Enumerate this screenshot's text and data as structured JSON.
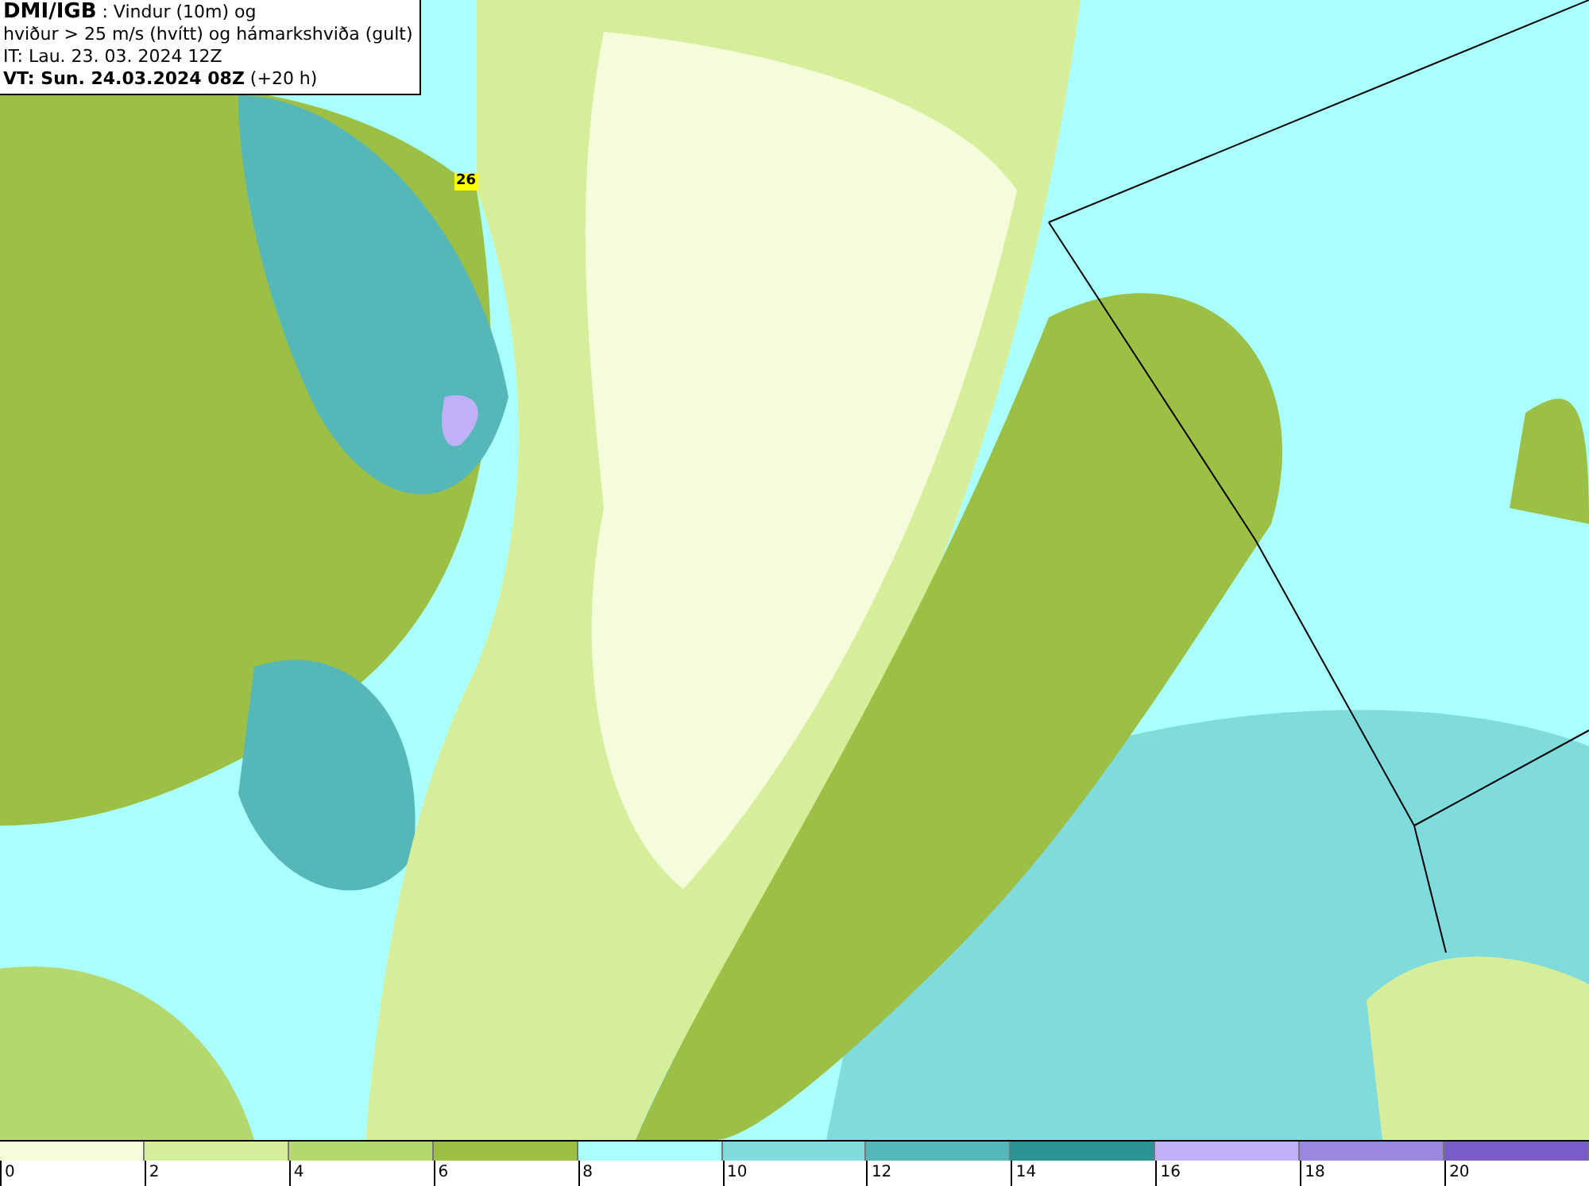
{
  "title_box": {
    "source": "DMI/IGB",
    "description": " : Vindur (10m) og",
    "line_2": "hviður > 25 m/s (hvítt) og hámarkshviða (gult)",
    "initial_time": "IT: Lau. 23. 03. 2024 12Z",
    "valid_time": "VT: Sun. 24.03.2024 08Z",
    "lead": " (+20 h)"
  },
  "map": {
    "gust_label": "26"
  },
  "legend": [
    {
      "label": "0",
      "color": "#f5fcdc"
    },
    {
      "label": "2",
      "color": "#d6ee9a"
    },
    {
      "label": "4",
      "color": "#b5d86e"
    },
    {
      "label": "6",
      "color": "#9cbf45"
    },
    {
      "label": "8",
      "color": "#aaffff"
    },
    {
      "label": "10",
      "color": "#80dcdc"
    },
    {
      "label": "12",
      "color": "#55b7b7"
    },
    {
      "label": "14",
      "color": "#2a9494"
    },
    {
      "label": "16",
      "color": "#c0b0f8"
    },
    {
      "label": "18",
      "color": "#9a88e0"
    },
    {
      "label": "20",
      "color": "#7a5cc8"
    }
  ]
}
